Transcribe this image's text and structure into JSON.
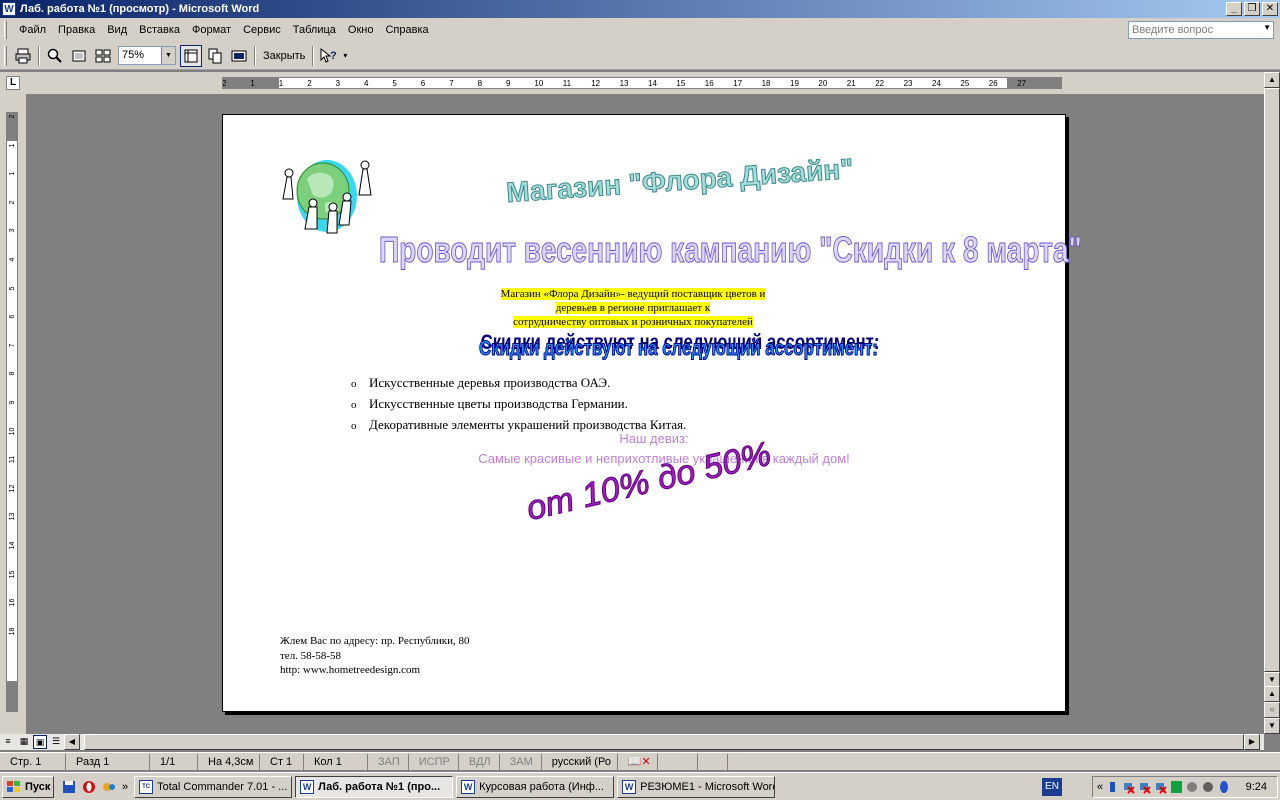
{
  "window": {
    "title": "Лаб. работа №1 (просмотр) - Microsoft Word",
    "app_icon_letter": "W"
  },
  "menu": {
    "items": [
      "Файл",
      "Правка",
      "Вид",
      "Вставка",
      "Формат",
      "Сервис",
      "Таблица",
      "Окно",
      "Справка"
    ],
    "ask_placeholder": "Введите вопрос"
  },
  "toolbar": {
    "zoom_value": "75%",
    "close_label": "Закрыть"
  },
  "ruler": {
    "horizontal_numbers": [
      "2",
      "1",
      "1",
      "2",
      "3",
      "4",
      "5",
      "6",
      "7",
      "8",
      "9",
      "10",
      "11",
      "12",
      "13",
      "14",
      "15",
      "16",
      "17",
      "18",
      "19",
      "20",
      "21",
      "22",
      "23",
      "24",
      "25",
      "26",
      "27"
    ],
    "vertical_numbers": [
      "2",
      "1",
      "1",
      "2",
      "3",
      "4",
      "5",
      "6",
      "7",
      "8",
      "9",
      "10",
      "11",
      "12",
      "13",
      "14",
      "15",
      "16",
      "18"
    ]
  },
  "document": {
    "shop_title": "Магазин \"Флора Дизайн\"",
    "campaign": "Проводит весеннию кампанию \"Скидки к 8 марта\"",
    "intro_lines": [
      "Магазин «Флора Дизайн»- ведущий поставщик цветов и",
      "деревьев в регионе приглашает к",
      "сотрудничеству оптовых и розничных покупателей"
    ],
    "assortment_heading": "Скидки действуют на следующий ассортимент:",
    "items": [
      "Искусственные деревья производства ОАЭ.",
      "Искусственные цветы производства Германии.",
      "Декоративные элементы украшений производства Китая."
    ],
    "motto_label": "Наш девиз:",
    "motto_text": "Самые красивые и неприхотливые украшения в каждый дом!",
    "discount": "от 10% до 50%",
    "contact_lines": [
      "Жлем Вас по адресу: пр. Республики, 80",
      "тел. 58-58-58",
      "http: www.hometreedesign.com"
    ]
  },
  "statusbar": {
    "page": "Стр. 1",
    "section": "Разд 1",
    "pages": "1/1",
    "position": "На 4,3см",
    "line": "Ст 1",
    "column": "Кол 1",
    "rec": "ЗАП",
    "trk": "ИСПР",
    "ext": "ВДЛ",
    "ovr": "ЗАМ",
    "language": "русский (Ро"
  },
  "taskbar": {
    "start_label": "Пуск",
    "tasks": [
      {
        "label": "Total Commander 7.01 - ...",
        "icon": "TC",
        "active": false
      },
      {
        "label": "Лаб. работа №1 (про...",
        "icon": "W",
        "active": true
      },
      {
        "label": "Курсовая работа (Инф...",
        "icon": "W",
        "active": false
      },
      {
        "label": "РЕЗЮМЕ1 - Microsoft Word",
        "icon": "W",
        "active": false
      }
    ],
    "language": "EN",
    "clock": "9:24"
  },
  "colors": {
    "titlebar_start": "#0a246a",
    "titlebar_end": "#a6caf0",
    "shop_title": "#a6dcdc",
    "campaign": "#e0d4f8",
    "highlight": "#ffff00",
    "assortment": "#1e90ff",
    "motto": "#c080d8",
    "discount": "#a020c0"
  }
}
